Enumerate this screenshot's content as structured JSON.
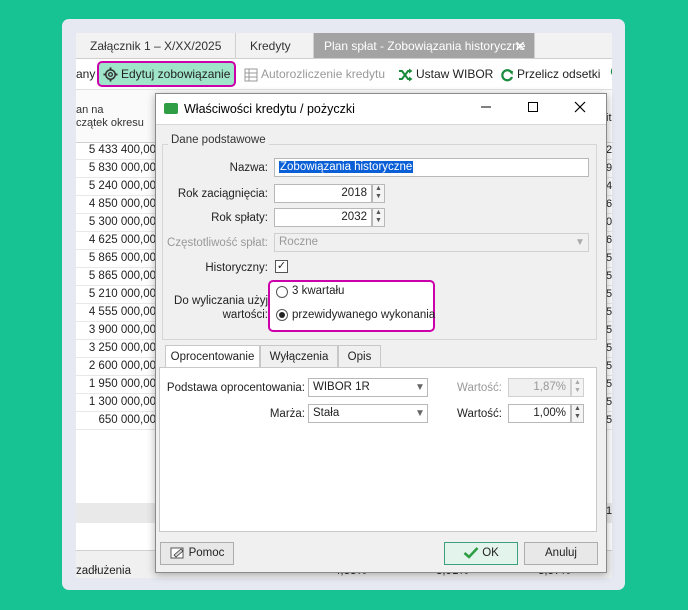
{
  "tabs": [
    {
      "label": "Załącznik 1 – X/XX/2025"
    },
    {
      "label": "Kredyty"
    },
    {
      "label": "Plan spłat - Zobowiązania historyczne",
      "close": "✕"
    }
  ],
  "toolbar": {
    "cut_label": "any",
    "edit_label": "Edytuj zobowiązanie",
    "auto_label": "Autorozliczenie kredytu",
    "wibor_label": "Ustaw WIBOR",
    "recalc_label": "Przelicz odsetki"
  },
  "grid": {
    "header_line1": "an na",
    "header_line2": "czątek okresu",
    "header_right": "ita",
    "rows": [
      {
        "value": "5 433 400,00",
        "right": "20"
      },
      {
        "value": "5 830 000,00",
        "right": "90"
      },
      {
        "value": "5 240 000,00",
        "right": "40"
      },
      {
        "value": "4 850 000,00",
        "right": "68"
      },
      {
        "value": "5 300 000,00",
        "right": "00"
      },
      {
        "value": "4 625 000,00",
        "right": "68"
      },
      {
        "value": "5 865 000,00",
        "right": "55"
      },
      {
        "value": "5 865 000,00",
        "right": "55"
      },
      {
        "value": "5 210 000,00",
        "right": "55"
      },
      {
        "value": "4 555 000,00",
        "right": "55"
      },
      {
        "value": "3 900 000,00",
        "right": "50"
      },
      {
        "value": "3 250 000,00",
        "right": "50"
      },
      {
        "value": "2 600 000,00",
        "right": "50"
      },
      {
        "value": "1 950 000,00",
        "right": "50"
      },
      {
        "value": "1 300 000,00",
        "right": "50"
      },
      {
        "value": "650 000,00",
        "right": "50"
      }
    ],
    "gray_right": "10",
    "footer_label": "zadłużenia",
    "footer_pcts": [
      "4,33%",
      "3,91%",
      "3,57%"
    ]
  },
  "dialog": {
    "title": "Właściwości kredytu / pożyczki",
    "group_title": "Dane podstawowe",
    "name_label": "Nazwa:",
    "name_value": "Zobowiązania historyczne",
    "start_year_label": "Rok zaciągnięcia:",
    "start_year_value": "2018",
    "end_year_label": "Rok spłaty:",
    "end_year_value": "2032",
    "frequency_label": "Częstotliwość spłat:",
    "frequency_value": "Roczne",
    "historical_label": "Historyczny:",
    "historical_check": "✓",
    "calc_label_1": "Do wyliczania użyj",
    "calc_label_2": "wartości:",
    "radio_1": "3 kwartału",
    "radio_2": "przewidywanego wykonania",
    "tabs": [
      "Oprocentowanie",
      "Wyłączenia",
      "Opis"
    ],
    "rate_basis_label": "Podstawa oprocentowania:",
    "rate_basis_value": "WIBOR 1R",
    "value_label_1": "Wartość:",
    "value_1": "1,87%",
    "margin_label": "Marża:",
    "margin_value": "Stała",
    "value_label_2": "Wartość:",
    "value_2": "1,00%",
    "help_label": "Pomoc",
    "ok_label": "OK",
    "cancel_label": "Anuluj"
  },
  "colors": {
    "background": "#17c293",
    "highlight": "#cc00aa",
    "edit_button_fill": "#9ee5c9"
  }
}
